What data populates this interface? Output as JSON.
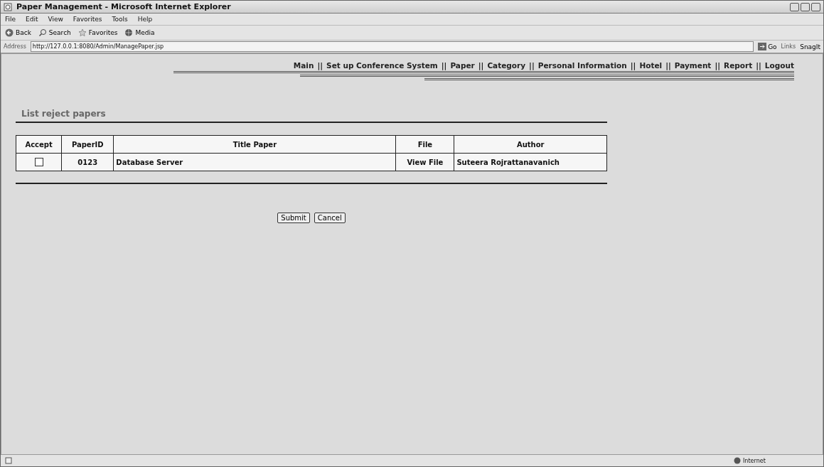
{
  "window": {
    "title": "Paper Management - Microsoft Internet Explorer"
  },
  "menu_bar": [
    "File",
    "Edit",
    "View",
    "Favorites",
    "Tools",
    "Help"
  ],
  "toolbar": [
    {
      "kind": "back",
      "label": "Back"
    },
    {
      "kind": "search",
      "label": "Search"
    },
    {
      "kind": "favorites",
      "label": "Favorites"
    },
    {
      "kind": "media",
      "label": "Media"
    }
  ],
  "address_bar": {
    "label": "Address",
    "value": "http://127.0.0.1:8080/Admin/ManagePaper.jsp",
    "go": "Go",
    "links": "Links",
    "snagit": "SnagIt"
  },
  "nav": {
    "separator": "||",
    "items": [
      "Main",
      "Set up Conference System",
      "Paper",
      "Category",
      "Personal Information",
      "Hotel",
      "Payment",
      "Report",
      "Logout"
    ]
  },
  "section_title": "List reject papers",
  "table": {
    "columns": [
      "Accept",
      "PaperID",
      "Title Paper",
      "File",
      "Author"
    ],
    "rows": [
      {
        "checked": false,
        "paper_id": "0123",
        "title": "Database Server",
        "file": "View File",
        "author": "Suteera Rojrattanavanich"
      }
    ]
  },
  "buttons": [
    "Submit",
    "Cancel"
  ],
  "status_bar": {
    "zone": "Internet"
  }
}
